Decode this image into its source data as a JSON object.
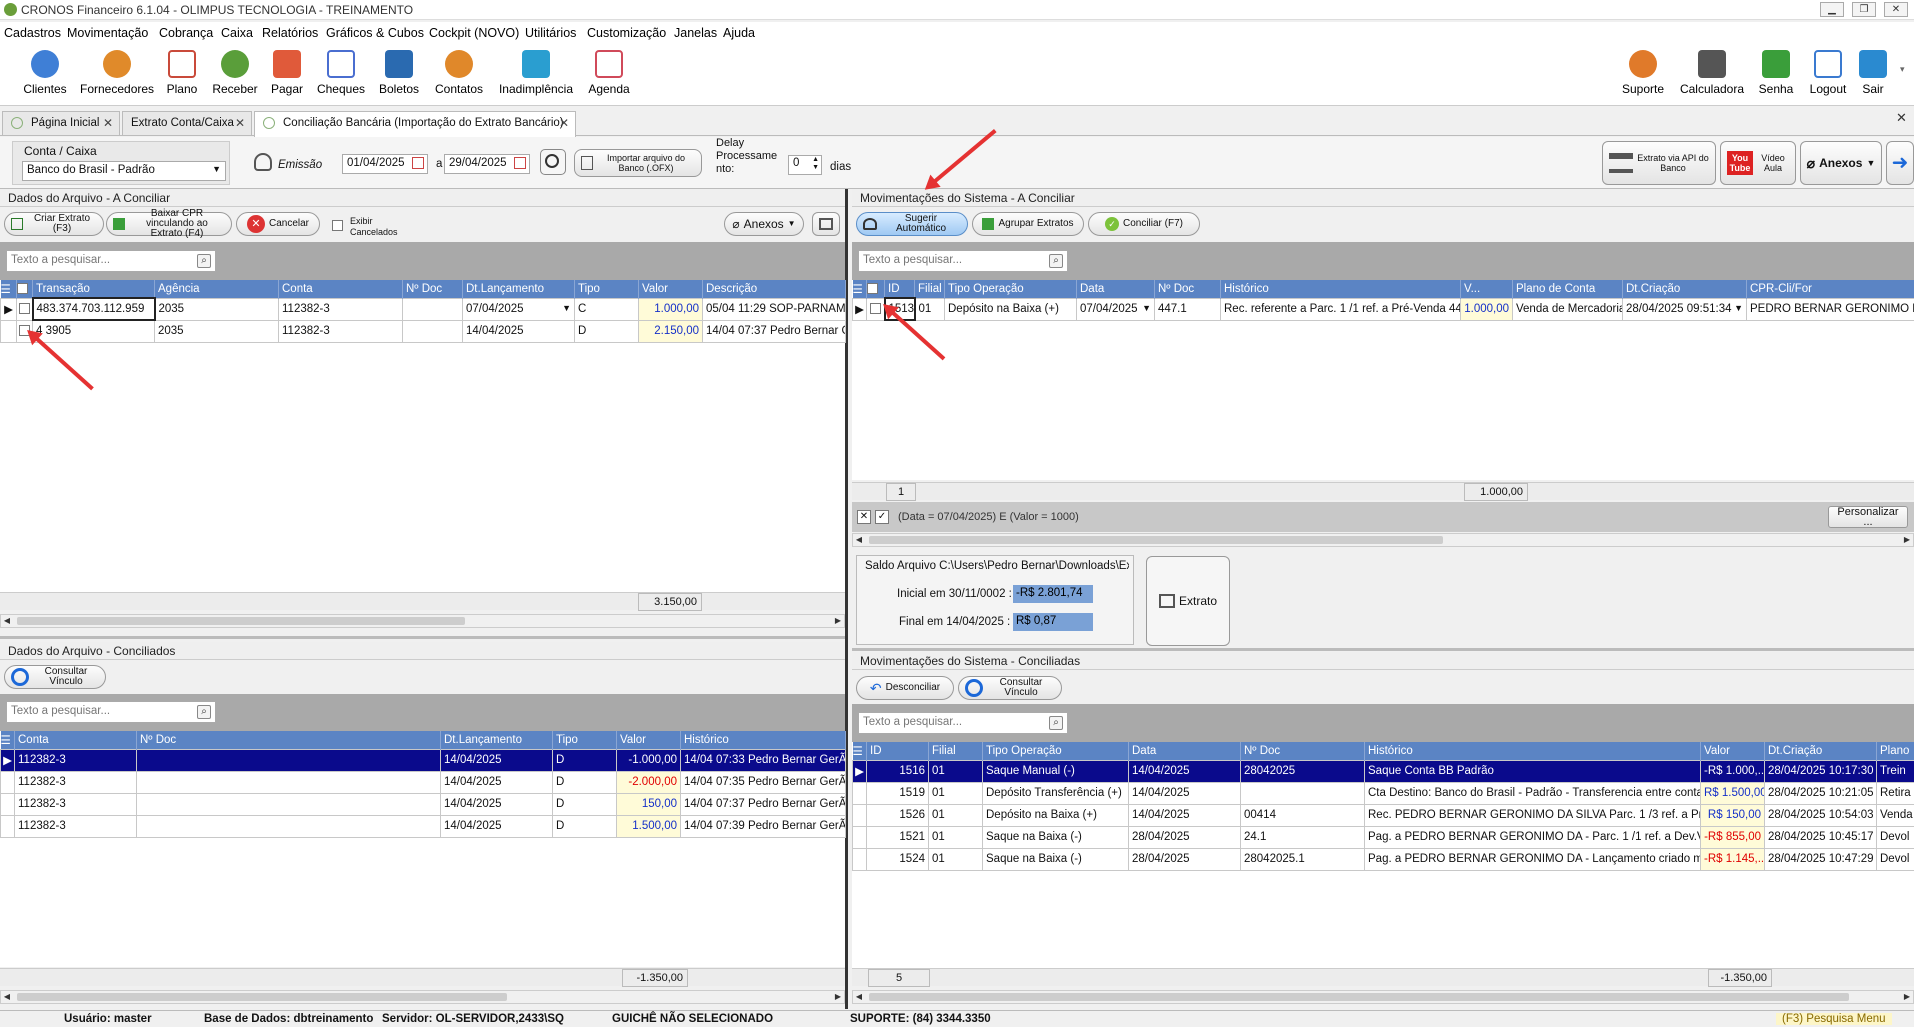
{
  "window": {
    "title": "CRONOS Financeiro 6.1.04 - OLIMPUS TECNOLOGIA - TREINAMENTO"
  },
  "menu": [
    "Cadastros",
    "Movimentação",
    "Cobrança",
    "Caixa",
    "Relatórios",
    "Gráficos & Cubos",
    "Cockpit (NOVO)",
    "Utilitários",
    "Customização",
    "Janelas",
    "Ajuda"
  ],
  "toolbar_left": [
    {
      "label": "Clientes",
      "icon": "clients-icon",
      "color": "#3f7fd6"
    },
    {
      "label": "Fornecedores",
      "icon": "supplier-icon",
      "color": "#e08a2a"
    },
    {
      "label": "Plano",
      "icon": "chart-of-accounts-icon",
      "color": "#c94a3a"
    },
    {
      "label": "Receber",
      "icon": "receive-icon",
      "color": "#5a9e3a"
    },
    {
      "label": "Pagar",
      "icon": "pay-icon",
      "color": "#e05a3a"
    },
    {
      "label": "Cheques",
      "icon": "cheque-icon",
      "color": "#4a6ed0"
    },
    {
      "label": "Boletos",
      "icon": "boleto-icon",
      "color": "#2a6ab0"
    },
    {
      "label": "Contatos",
      "icon": "contacts-icon",
      "color": "#e0882a"
    },
    {
      "label": "Inadimplência",
      "icon": "default-chart-icon",
      "color": "#2a9ed0"
    },
    {
      "label": "Agenda",
      "icon": "calendar-icon",
      "color": "#d04a5a"
    }
  ],
  "toolbar_right": [
    {
      "label": "Suporte",
      "icon": "support-icon",
      "color": "#e07a2a"
    },
    {
      "label": "Calculadora",
      "icon": "calculator-icon",
      "color": "#555"
    },
    {
      "label": "Senha",
      "icon": "lock-icon",
      "color": "#3a9e3a"
    },
    {
      "label": "Logout",
      "icon": "logout-icon",
      "color": "#3a7ad0"
    },
    {
      "label": "Sair",
      "icon": "exit-icon",
      "color": "#2a8ad0"
    }
  ],
  "tabs": [
    {
      "label": "Página Inicial"
    },
    {
      "label": "Extrato Conta/Caixa"
    },
    {
      "label": "Conciliação Bancária (Importação do Extrato Bancário)"
    }
  ],
  "filter": {
    "account_label": "Conta / Caixa",
    "account_value": "Banco do Brasil - Padrão",
    "emissao_label": "Emissão",
    "date_from": "01/04/2025",
    "date_to_prefix": "a",
    "date_to": "29/04/2025",
    "import_button": "Importar arquivo do Banco (.OFX)",
    "delay_label": "Delay Processame nto:",
    "delay_value": "0",
    "delay_unit": "dias",
    "api_button": "Extrato via API do Banco",
    "youtube_label": "You Tube",
    "video_label": "Vídeo Aula",
    "anexos_label": "Anexos"
  },
  "left_top": {
    "title": "Dados do Arquivo - A Conciliar",
    "btn_create": "Criar Extrato (F3)",
    "btn_baixar": "Baixar CPR vinculando ao Extrato (F4)",
    "btn_cancel": "Cancelar",
    "chk_cancelados": "Exibir Cancelados",
    "btn_anexos": "Anexos",
    "search_placeholder": "Texto a pesquisar...",
    "columns": [
      "Transação",
      "Agência",
      "Conta",
      "Nº Doc",
      "Dt.Lançamento",
      "Tipo",
      "Valor",
      "Descrição"
    ],
    "rows": [
      [
        "483.374.703.112.959",
        "2035",
        "112382-3",
        "",
        "07/04/2025",
        "C",
        "1.000,00",
        "05/04 11:29 SOP-PARNAMIR"
      ],
      [
        "4 3905",
        "2035",
        "112382-3",
        "",
        "14/04/2025",
        "D",
        "2.150,00",
        "14/04 07:37 Pedro Bernar Ge"
      ]
    ],
    "total": "3.150,00"
  },
  "left_bottom": {
    "title": "Dados do Arquivo - Conciliados",
    "btn_consultar": "Consultar Vínculo",
    "search_placeholder": "Texto a pesquisar...",
    "columns": [
      "Conta",
      "Nº Doc",
      "Dt.Lançamento",
      "Tipo",
      "Valor",
      "Histórico"
    ],
    "rows": [
      [
        "112382-3",
        "",
        "14/04/2025",
        "D",
        "-1.000,00",
        "14/04 07:33 Pedro Bernar GerÃ´n"
      ],
      [
        "112382-3",
        "",
        "14/04/2025",
        "D",
        "-2.000,00",
        "14/04 07:35 Pedro Bernar GerÃ´"
      ],
      [
        "112382-3",
        "",
        "14/04/2025",
        "D",
        "150,00",
        "14/04 07:37 Pedro Bernar GerÃ´"
      ],
      [
        "112382-3",
        "",
        "14/04/2025",
        "D",
        "1.500,00",
        "14/04 07:39 Pedro Bernar GerÃ´"
      ]
    ],
    "total": "-1.350,00"
  },
  "right_top": {
    "title": "Movimentações do Sistema - A Conciliar",
    "btn_sugerir": "Sugerir Automático",
    "btn_agrupar": "Agrupar Extratos",
    "btn_conciliar": "Conciliar (F7)",
    "search_placeholder": "Texto a pesquisar...",
    "columns": [
      "ID",
      "Filial",
      "Tipo Operação",
      "Data",
      "Nº Doc",
      "Histórico",
      "V...",
      "Plano de Conta",
      "Dt.Criação",
      "CPR-Cli/For"
    ],
    "rows": [
      [
        "1513",
        "01",
        "Depósito na Baixa (+)",
        "07/04/2025",
        "447.1",
        "Rec. referente a Parc. 1 /1  ref. a Pré-Venda 447",
        "1.000,00",
        "Venda de Mercadoria",
        "28/04/2025 09:51:34",
        "PEDRO BERNAR GERONIMO DA S"
      ]
    ],
    "count": "1",
    "total": "1.000,00",
    "filter_text": "(Data = 07/04/2025) E (Valor = 1000)",
    "btn_personalizar": "Personalizar ...",
    "saldo_title": "Saldo Arquivo C:\\Users\\Pedro Bernar\\Downloads\\Ex",
    "inicial_label": "Inicial em 30/11/0002 :",
    "inicial_value": "-R$ 2.801,74",
    "final_label": "Final em 14/04/2025 :",
    "final_value": "R$ 0,87",
    "btn_extrato": "Extrato"
  },
  "right_bottom": {
    "title": "Movimentações do Sistema - Conciliadas",
    "btn_desconciliar": "Desconciliar",
    "btn_consultar": "Consultar Vínculo",
    "search_placeholder": "Texto a pesquisar...",
    "columns": [
      "ID",
      "Filial",
      "Tipo Operação",
      "Data",
      "Nº Doc",
      "Histórico",
      "Valor",
      "Dt.Criação",
      "Plano"
    ],
    "rows": [
      [
        "1516",
        "01",
        "Saque Manual (-)",
        "14/04/2025",
        "28042025",
        "Saque Conta BB Padrão",
        "-R$ 1.000,...",
        "28/04/2025 10:17:30",
        "Trein"
      ],
      [
        "1519",
        "01",
        "Depósito Transferência (+)",
        "14/04/2025",
        "",
        "Cta Destino: Banco do Brasil - Padrão - Transferencia entre contas",
        "R$ 1.500,00",
        "28/04/2025 10:21:05",
        "Retira"
      ],
      [
        "1526",
        "01",
        "Depósito na Baixa (+)",
        "14/04/2025",
        "00414",
        "Rec. PEDRO BERNAR GERONIMO DA SILVA  Parc. 1 /3  ref. a Pré-...",
        "R$ 150,00",
        "28/04/2025 10:54:03",
        "Venda"
      ],
      [
        "1521",
        "01",
        "Saque na Baixa (-)",
        "28/04/2025",
        "24.1",
        "Pag. a PEDRO BERNAR GERONIMO DA   - Parc. 1 /1  ref. a Dev.V...",
        "-R$ 855,00",
        "28/04/2025 10:45:17",
        "Devol"
      ],
      [
        "1524",
        "01",
        "Saque na Baixa (-)",
        "28/04/2025",
        "28042025.1",
        "Pag. a PEDRO BERNAR GERONIMO DA   - Lançamento criado man...",
        "-R$ 1.145,...",
        "28/04/2025 10:47:29",
        "Devol"
      ]
    ],
    "count": "5",
    "total": "-1.350,00"
  },
  "statusbar": {
    "usuario": "Usuário: master",
    "base": "Base de Dados: dbtreinamento",
    "servidor": "Servidor: OL-SERVIDOR,2433\\SQ",
    "guiche": "GUICHÊ NÃO SELECIONADO",
    "suporte": "SUPORTE: (84) 3344.3350",
    "hint": "(F3) Pesquisa Menu"
  },
  "colors": {
    "grid_header": "#5b84c4",
    "selected_row": "#0a0a8c",
    "negative": "#e00000",
    "positive": "#1530c8",
    "annotation_arrow": "#e53232"
  }
}
